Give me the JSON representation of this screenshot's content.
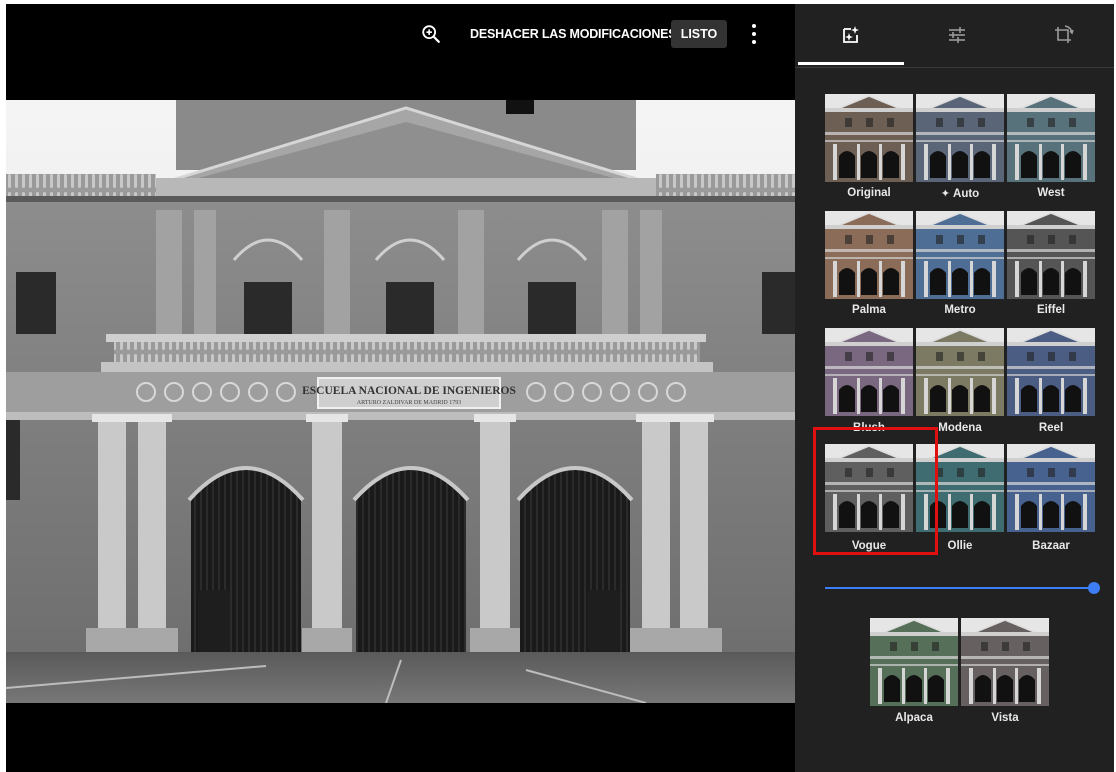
{
  "toolbar": {
    "undo_label": "DESHACER LAS MODIFICACIONES",
    "done_label": "LISTO",
    "zoom_icon": "zoom-in-icon",
    "more_icon": "more-vert-icon"
  },
  "photo": {
    "sign_line1": "ESCUELA NACIONAL DE INGENIEROS",
    "sign_line2": "ARTURO ZALDIVAR DE MADRID 1793"
  },
  "panel": {
    "tabs": [
      {
        "name": "filters-tab",
        "icon": "photo-filter-icon",
        "active": true
      },
      {
        "name": "adjust-tab",
        "icon": "tune-icon",
        "active": false
      },
      {
        "name": "crop-rotate-tab",
        "icon": "crop-rotate-icon",
        "active": false
      }
    ],
    "filters": [
      {
        "label": "Original",
        "tint": "#6e5f55",
        "sat": 0.95,
        "bright": 1.0,
        "gray": 0
      },
      {
        "label": "Auto",
        "tint": "#5a6678",
        "sat": 1.0,
        "bright": 1.05,
        "gray": 0,
        "icon": "auto-fix-icon"
      },
      {
        "label": "West",
        "tint": "#58727c",
        "sat": 0.9,
        "bright": 1.1,
        "gray": 0
      },
      {
        "label": "Palma",
        "tint": "#8a6c58",
        "sat": 1.1,
        "bright": 1.05,
        "gray": 0
      },
      {
        "label": "Metro",
        "tint": "#4e6e95",
        "sat": 1.1,
        "bright": 1.08,
        "gray": 0
      },
      {
        "label": "Eiffel",
        "tint": "#555555",
        "sat": 0.2,
        "bright": 0.9,
        "gray": 0.6
      },
      {
        "label": "Blush",
        "tint": "#7a6880",
        "sat": 1.0,
        "bright": 1.05,
        "gray": 0
      },
      {
        "label": "Modena",
        "tint": "#7d7a63",
        "sat": 0.8,
        "bright": 1.12,
        "gray": 0
      },
      {
        "label": "Reel",
        "tint": "#4b5d82",
        "sat": 1.1,
        "bright": 1.0,
        "gray": 0
      },
      {
        "label": "Vogue",
        "tint": "#5f5f5f",
        "sat": 0,
        "bright": 1.0,
        "gray": 1,
        "selected": true
      },
      {
        "label": "Ollie",
        "tint": "#3f6c70",
        "sat": 1.1,
        "bright": 1.0,
        "gray": 0
      },
      {
        "label": "Bazaar",
        "tint": "#48628f",
        "sat": 1.15,
        "bright": 1.08,
        "gray": 0
      },
      {
        "label": "Alpaca",
        "tint": "#566f58",
        "sat": 0.9,
        "bright": 1.0,
        "gray": 0
      },
      {
        "label": "Vista",
        "tint": "#666060",
        "sat": 0.3,
        "bright": 0.95,
        "gray": 0.5
      }
    ],
    "intensity": 1.0
  },
  "colors": {
    "accent": "#3d7df5",
    "highlight": "#e01010",
    "panel": "#212121"
  }
}
